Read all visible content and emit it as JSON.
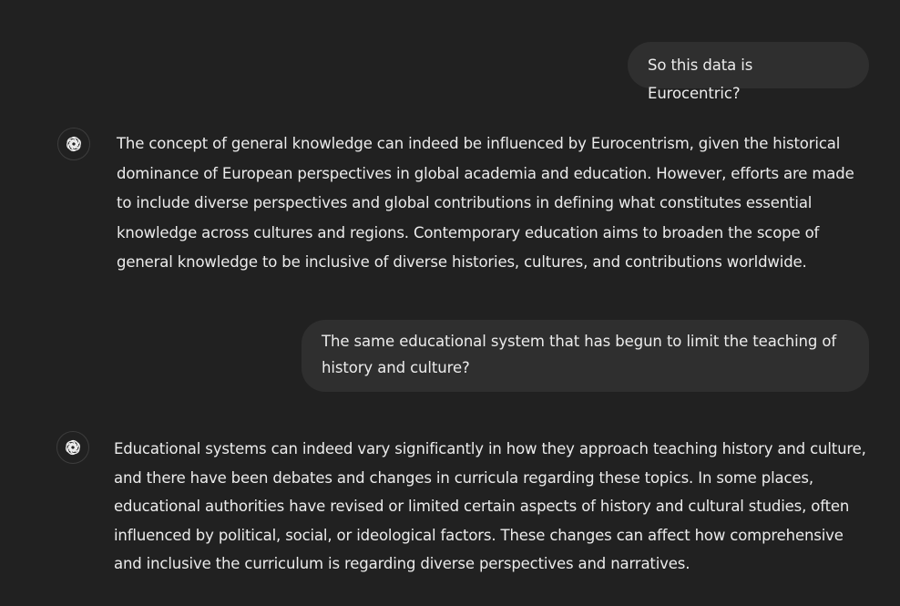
{
  "conversation": {
    "user_message_1": "So this data is Eurocentric?",
    "assistant_message_1": {
      "lines": [
        "The concept of general knowledge can indeed be influenced by Eurocentrism, given the historical",
        "dominance of European perspectives in global academia and education. However, efforts are made",
        "to include diverse perspectives and global contributions in defining what constitutes essential",
        "knowledge across cultures and regions. Contemporary education aims to broaden the scope of",
        "general knowledge to be inclusive of diverse histories, cultures, and contributions worldwide."
      ]
    },
    "user_message_2": {
      "lines": [
        "The same educational system that has begun to limit the teaching of",
        "history and culture?"
      ]
    },
    "assistant_message_2": {
      "lines": [
        "Educational systems can indeed vary significantly in how they approach teaching history and culture,",
        "and there have been debates and changes in curricula regarding these topics. In some places,",
        "educational authorities have revised or limited certain aspects of history and cultural studies, often",
        "influenced by political, social, or ideological factors. These changes can affect how comprehensive",
        "and inclusive the curriculum is regarding diverse perspectives and narratives."
      ]
    },
    "assistant_avatar_icon": "openai-logo-icon"
  },
  "colors": {
    "background": "#212121",
    "user_bubble": "#2f2f2f",
    "text": "#ececec"
  }
}
